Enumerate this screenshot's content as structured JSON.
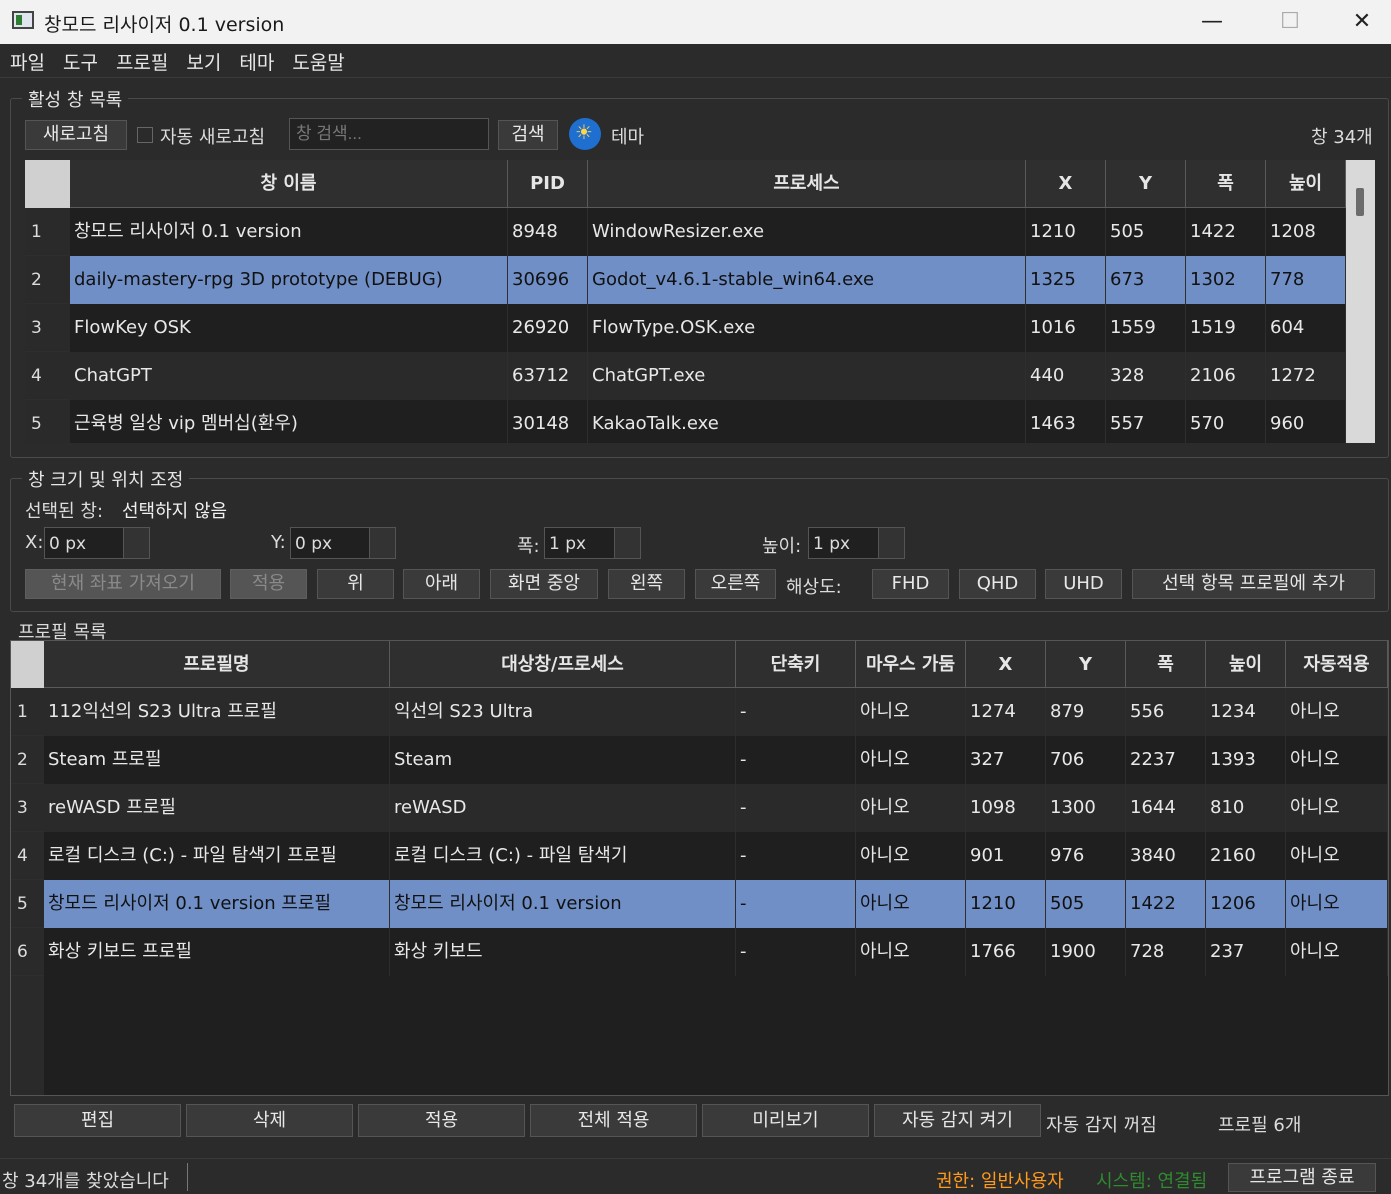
{
  "window": {
    "title": "창모드 리사이저 0.1 version",
    "min": "—",
    "max": "☐",
    "close": "✕"
  },
  "menu": [
    "파일",
    "도구",
    "프로필",
    "보기",
    "테마",
    "도움말"
  ],
  "active_windows": {
    "group_title": "활성 창 목록",
    "refresh_label": "새로고침",
    "auto_refresh_label": "자동 새로고침",
    "search_placeholder": "창 검색...",
    "search_label": "검색",
    "theme_label": "테마",
    "count_label": "창 34개",
    "columns": [
      "창 이름",
      "PID",
      "프로세스",
      "X",
      "Y",
      "폭",
      "높이"
    ],
    "rows": [
      {
        "num": "1",
        "name": "창모드 리사이저 0.1 version",
        "pid": "8948",
        "process": "WindowResizer.exe",
        "x": "1210",
        "y": "505",
        "w": "1422",
        "h": "1208"
      },
      {
        "num": "2",
        "name": "daily-mastery-rpg 3D prototype (DEBUG)",
        "pid": "30696",
        "process": "Godot_v4.6.1-stable_win64.exe",
        "x": "1325",
        "y": "673",
        "w": "1302",
        "h": "778"
      },
      {
        "num": "3",
        "name": "FlowKey OSK",
        "pid": "26920",
        "process": "FlowType.OSK.exe",
        "x": "1016",
        "y": "1559",
        "w": "1519",
        "h": "604"
      },
      {
        "num": "4",
        "name": "ChatGPT",
        "pid": "63712",
        "process": "ChatGPT.exe",
        "x": "440",
        "y": "328",
        "w": "2106",
        "h": "1272"
      },
      {
        "num": "5",
        "name": "근육병 일상 vip 멤버십(환우)",
        "pid": "30148",
        "process": "KakaoTalk.exe",
        "x": "1463",
        "y": "557",
        "w": "570",
        "h": "960"
      }
    ],
    "selected_row": 1
  },
  "adjust": {
    "group_title": "창 크기 및 위치 조정",
    "selected_label": "선택된 창:",
    "selected_value": "선택하지 않음",
    "x_label": "X:",
    "x_value": "0 px",
    "y_label": "Y:",
    "y_value": "0 px",
    "w_label": "폭:",
    "w_value": "1 px",
    "h_label": "높이:",
    "h_value": "1 px",
    "get_coords": "현재 좌표 가져오기",
    "apply": "적용",
    "up": "위",
    "down": "아래",
    "center": "화면 중앙",
    "left": "왼쪽",
    "right": "오른쪽",
    "resolution_label": "해상도:",
    "fhd": "FHD",
    "qhd": "QHD",
    "uhd": "UHD",
    "add_profile": "선택 항목 프로필에 추가"
  },
  "profiles": {
    "title": "프로필 목록",
    "columns": [
      "프로필명",
      "대상창/프로세스",
      "단축키",
      "마우스 가둠",
      "X",
      "Y",
      "폭",
      "높이",
      "자동적용"
    ],
    "rows": [
      {
        "num": "1",
        "name": "112익선의 S23 Ultra 프로필",
        "target": "익선의 S23 Ultra",
        "hotkey": "-",
        "mouse": "아니오",
        "x": "1274",
        "y": "879",
        "w": "556",
        "h": "1234",
        "auto": "아니오"
      },
      {
        "num": "2",
        "name": "Steam 프로필",
        "target": "Steam",
        "hotkey": "-",
        "mouse": "아니오",
        "x": "327",
        "y": "706",
        "w": "2237",
        "h": "1393",
        "auto": "아니오"
      },
      {
        "num": "3",
        "name": "reWASD 프로필",
        "target": "reWASD",
        "hotkey": "-",
        "mouse": "아니오",
        "x": "1098",
        "y": "1300",
        "w": "1644",
        "h": "810",
        "auto": "아니오"
      },
      {
        "num": "4",
        "name": "로컬 디스크 (C:) - 파일 탐색기 프로필",
        "target": "로컬 디스크 (C:) - 파일 탐색기",
        "hotkey": "-",
        "mouse": "아니오",
        "x": "901",
        "y": "976",
        "w": "3840",
        "h": "2160",
        "auto": "아니오"
      },
      {
        "num": "5",
        "name": "창모드 리사이저 0.1 version 프로필",
        "target": "창모드 리사이저 0.1 version",
        "hotkey": "-",
        "mouse": "아니오",
        "x": "1210",
        "y": "505",
        "w": "1422",
        "h": "1206",
        "auto": "아니오"
      },
      {
        "num": "6",
        "name": "화상 키보드 프로필",
        "target": "화상 키보드",
        "hotkey": "-",
        "mouse": "아니오",
        "x": "1766",
        "y": "1900",
        "w": "728",
        "h": "237",
        "auto": "아니오"
      }
    ],
    "selected_row": 4,
    "edit": "편집",
    "delete": "삭제",
    "apply": "적용",
    "apply_all": "전체 적용",
    "preview": "미리보기",
    "auto_detect_on": "자동 감지 켜기",
    "auto_detect_status": "자동 감지 꺼짐",
    "count_label": "프로필 6개"
  },
  "status": {
    "message": "창 34개를 찾았습니다",
    "permission": "권한: 일반사용자",
    "system": "시스템: 연결됨",
    "exit": "프로그램 종료",
    "permission_color": "#ff9a1a",
    "system_color": "#2e8b2e"
  }
}
